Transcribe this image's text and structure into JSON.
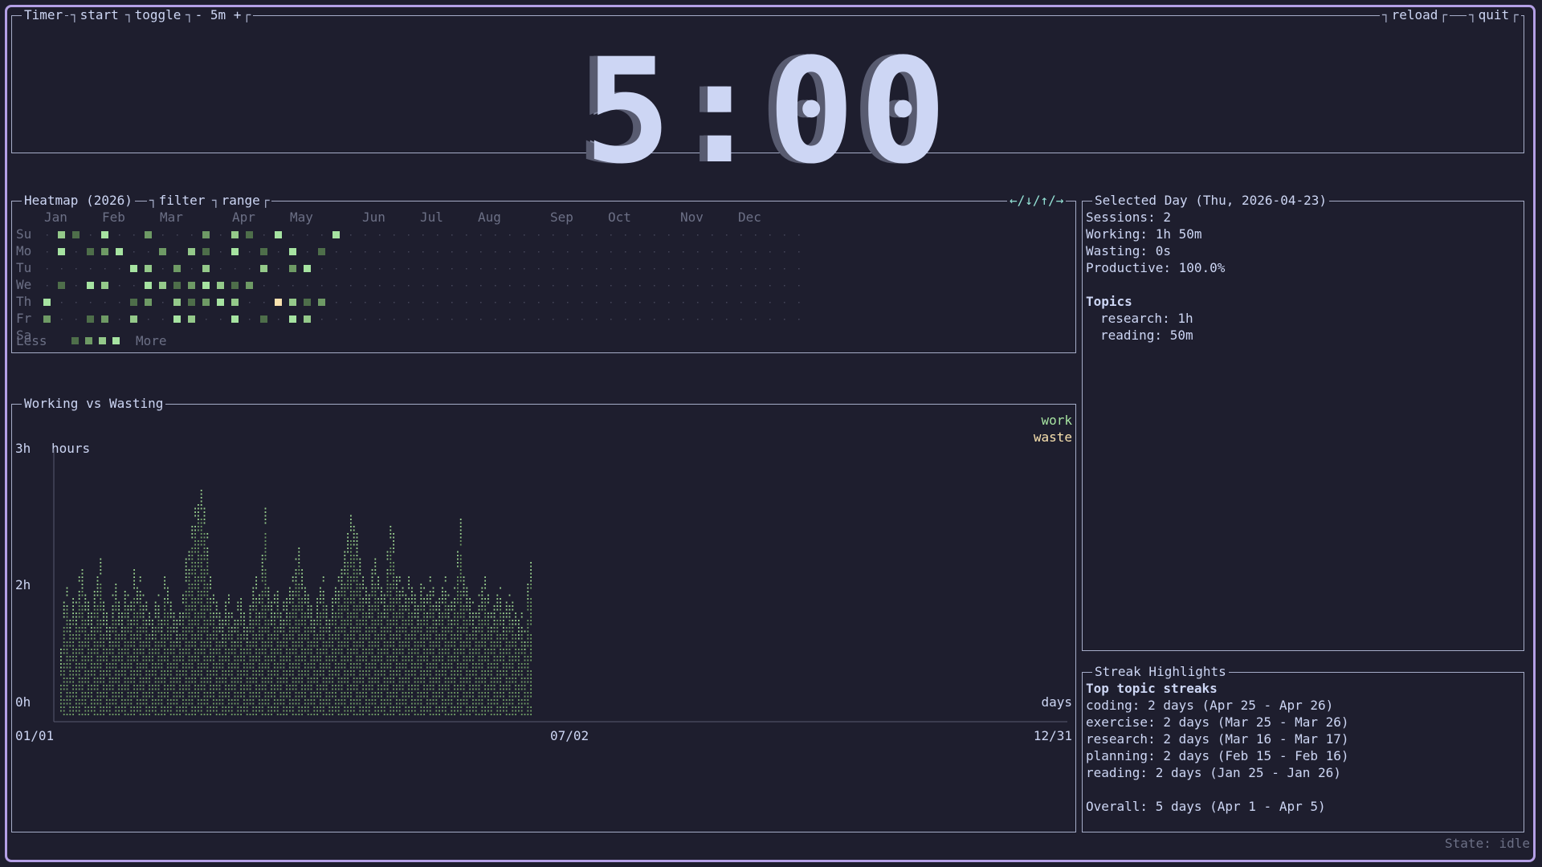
{
  "timer_panel": {
    "title": "Timer",
    "tabs": [
      "start",
      "toggle",
      "- 5m +"
    ],
    "right_tabs": [
      "reload",
      "quit"
    ],
    "time": "5:00"
  },
  "heatmap": {
    "title": "Heatmap (2026)",
    "tabs": [
      "filter",
      "range"
    ],
    "nav": "←/↓/↑/→",
    "months": [
      "Jan",
      "Feb",
      "Mar",
      "Apr",
      "May",
      "Jun",
      "Jul",
      "Aug",
      "Sep",
      "Oct",
      "Nov",
      "Dec"
    ],
    "days": [
      "Su",
      "Mo",
      "Tu",
      "We",
      "Th",
      "Fr",
      "Sa"
    ],
    "legend_less": "Less",
    "legend_more": "More",
    "colors": {
      "empty": "#313244",
      "l1": "#4e6e4a",
      "l2": "#6e9a65",
      "l3": "#94c98a",
      "l4": "#a6e3a1",
      "selected": "#f9e2af"
    },
    "cells": [
      [
        0,
        1,
        1,
        0,
        1,
        0,
        0,
        1,
        0,
        0,
        0,
        1,
        0,
        1,
        1,
        0,
        1,
        0,
        0,
        0,
        1,
        0,
        0,
        0,
        0,
        0,
        0,
        0,
        0,
        0,
        0,
        0,
        0,
        0,
        0,
        0,
        0,
        0,
        0,
        0,
        0,
        0,
        0,
        0,
        0,
        0,
        0,
        0,
        0,
        0,
        0,
        0,
        0
      ],
      [
        0,
        1,
        0,
        1,
        1,
        1,
        0,
        0,
        1,
        0,
        1,
        1,
        0,
        1,
        0,
        1,
        0,
        1,
        0,
        1,
        0,
        0,
        0,
        0,
        0,
        0,
        0,
        0,
        0,
        0,
        0,
        0,
        0,
        0,
        0,
        0,
        0,
        0,
        0,
        0,
        0,
        0,
        0,
        0,
        0,
        0,
        0,
        0,
        0,
        0,
        0,
        0,
        0
      ],
      [
        0,
        0,
        0,
        0,
        0,
        0,
        1,
        1,
        0,
        1,
        0,
        1,
        0,
        0,
        0,
        1,
        0,
        1,
        1,
        0,
        0,
        0,
        0,
        0,
        0,
        0,
        0,
        0,
        0,
        0,
        0,
        0,
        0,
        0,
        0,
        0,
        0,
        0,
        0,
        0,
        0,
        0,
        0,
        0,
        0,
        0,
        0,
        0,
        0,
        0,
        0,
        0,
        0
      ],
      [
        0,
        1,
        0,
        1,
        1,
        0,
        0,
        1,
        1,
        1,
        1,
        1,
        1,
        1,
        1,
        0,
        0,
        0,
        0,
        0,
        0,
        0,
        0,
        0,
        0,
        0,
        0,
        0,
        0,
        0,
        0,
        0,
        0,
        0,
        0,
        0,
        0,
        0,
        0,
        0,
        0,
        0,
        0,
        0,
        0,
        0,
        0,
        0,
        0,
        0,
        0,
        0,
        0
      ],
      [
        1,
        0,
        0,
        0,
        0,
        0,
        1,
        1,
        0,
        1,
        1,
        1,
        1,
        1,
        0,
        0,
        2,
        1,
        1,
        1,
        0,
        0,
        0,
        0,
        0,
        0,
        0,
        0,
        0,
        0,
        0,
        0,
        0,
        0,
        0,
        0,
        0,
        0,
        0,
        0,
        0,
        0,
        0,
        0,
        0,
        0,
        0,
        0,
        0,
        0,
        0,
        0,
        0
      ],
      [
        1,
        0,
        0,
        1,
        1,
        0,
        1,
        0,
        0,
        1,
        1,
        0,
        0,
        1,
        0,
        1,
        0,
        1,
        1,
        0,
        0,
        0,
        0,
        0,
        0,
        0,
        0,
        0,
        0,
        0,
        0,
        0,
        0,
        0,
        0,
        0,
        0,
        0,
        0,
        0,
        0,
        0,
        0,
        0,
        0,
        0,
        0,
        0,
        0,
        0,
        0,
        0,
        0
      ],
      [
        1,
        0,
        0,
        0,
        1,
        0,
        0,
        0,
        0,
        0,
        1,
        0,
        0,
        1,
        1,
        1,
        1,
        1,
        1,
        1,
        0,
        0,
        0,
        0,
        0,
        0,
        0,
        0,
        0,
        0,
        0,
        0,
        0,
        0,
        0,
        0,
        0,
        0,
        0,
        0,
        0,
        0,
        0,
        0,
        0,
        0,
        0,
        0,
        0,
        0,
        0,
        0,
        0
      ]
    ]
  },
  "chart_panel": {
    "title": "Working vs Wasting",
    "legend": [
      {
        "name": "work",
        "color": "#a6e3a1"
      },
      {
        "name": "waste",
        "color": "#f9e2af"
      }
    ],
    "y_ticks": [
      "3h",
      "2h",
      "0h"
    ],
    "ylabel": "hours",
    "xlabel": "days",
    "x_ticks": [
      "01/01",
      "07/02",
      "12/31"
    ]
  },
  "chart_data": {
    "type": "area",
    "title": "Working vs Wasting",
    "xlabel": "days",
    "ylabel": "hours",
    "x_range": [
      "01/01",
      "12/31"
    ],
    "ylim": [
      0,
      3
    ],
    "series": [
      {
        "name": "work",
        "values": [
          0.8,
          1.3,
          1.5,
          1.2,
          1.4,
          1.3,
          1.6,
          1.7,
          1.4,
          1.3,
          1.2,
          1.5,
          1.6,
          1.8,
          1.3,
          1.2,
          1.1,
          1.4,
          1.6,
          1.3,
          1.2,
          1.5,
          1.4,
          1.3,
          1.7,
          1.5,
          1.6,
          1.4,
          1.3,
          1.2,
          1.1,
          1.3,
          1.4,
          1.2,
          1.6,
          1.5,
          1.3,
          1.2,
          1.1,
          1.2,
          1.4,
          1.8,
          1.9,
          2.2,
          2.4,
          2.5,
          2.6,
          2.4,
          2.1,
          1.6,
          1.4,
          1.3,
          1.2,
          1.1,
          1.3,
          1.4,
          1.2,
          1.1,
          1.3,
          1.4,
          1.2,
          1.1,
          1.3,
          1.5,
          1.6,
          1.4,
          1.9,
          2.4,
          1.5,
          1.3,
          1.4,
          1.5,
          1.2,
          1.3,
          1.4,
          1.5,
          1.6,
          1.8,
          2.0,
          1.7,
          1.5,
          1.4,
          1.3,
          1.2,
          1.4,
          1.5,
          1.6,
          1.3,
          1.2,
          1.4,
          1.5,
          1.6,
          1.7,
          1.9,
          2.1,
          2.3,
          2.2,
          2.1,
          1.8,
          1.6,
          1.5,
          1.4,
          1.7,
          1.8,
          1.6,
          1.5,
          1.4,
          1.9,
          2.2,
          2.1,
          1.7,
          1.6,
          1.5,
          1.4,
          1.6,
          1.5,
          1.4,
          1.3,
          1.6,
          1.5,
          1.4,
          1.6,
          1.5,
          1.3,
          1.4,
          1.5,
          1.6,
          1.4,
          1.3,
          1.5,
          1.9,
          2.3,
          1.6,
          1.5,
          1.4,
          1.3,
          1.2,
          1.4,
          1.5,
          1.6,
          1.4,
          1.2,
          1.3,
          1.4,
          1.5,
          1.2,
          1.3,
          1.4,
          1.3,
          1.2,
          1.1,
          1.2,
          1.0,
          1.6,
          1.8
        ]
      },
      {
        "name": "waste",
        "values": []
      }
    ]
  },
  "selected_day": {
    "title": "Selected Day (Thu, 2026-04-23)",
    "lines": [
      "Sessions: 2",
      "Working: 1h 50m",
      "Wasting: 0s",
      "Productive: 100.0%"
    ],
    "topics_heading": "Topics",
    "topics": [
      "research: 1h",
      "reading: 50m"
    ]
  },
  "streaks": {
    "title": "Streak Highlights",
    "heading": "Top topic streaks",
    "items": [
      "coding: 2 days (Apr 25 - Apr 26)",
      "exercise: 2 days (Mar 25 - Mar 26)",
      "research: 2 days (Mar 16 - Mar 17)",
      "planning: 2 days (Feb 15 - Feb 16)",
      "reading: 2 days (Jan 25 - Jan 26)"
    ],
    "overall": "Overall: 5 days (Apr 1 - Apr 5)"
  },
  "status": {
    "text": "State: idle"
  }
}
